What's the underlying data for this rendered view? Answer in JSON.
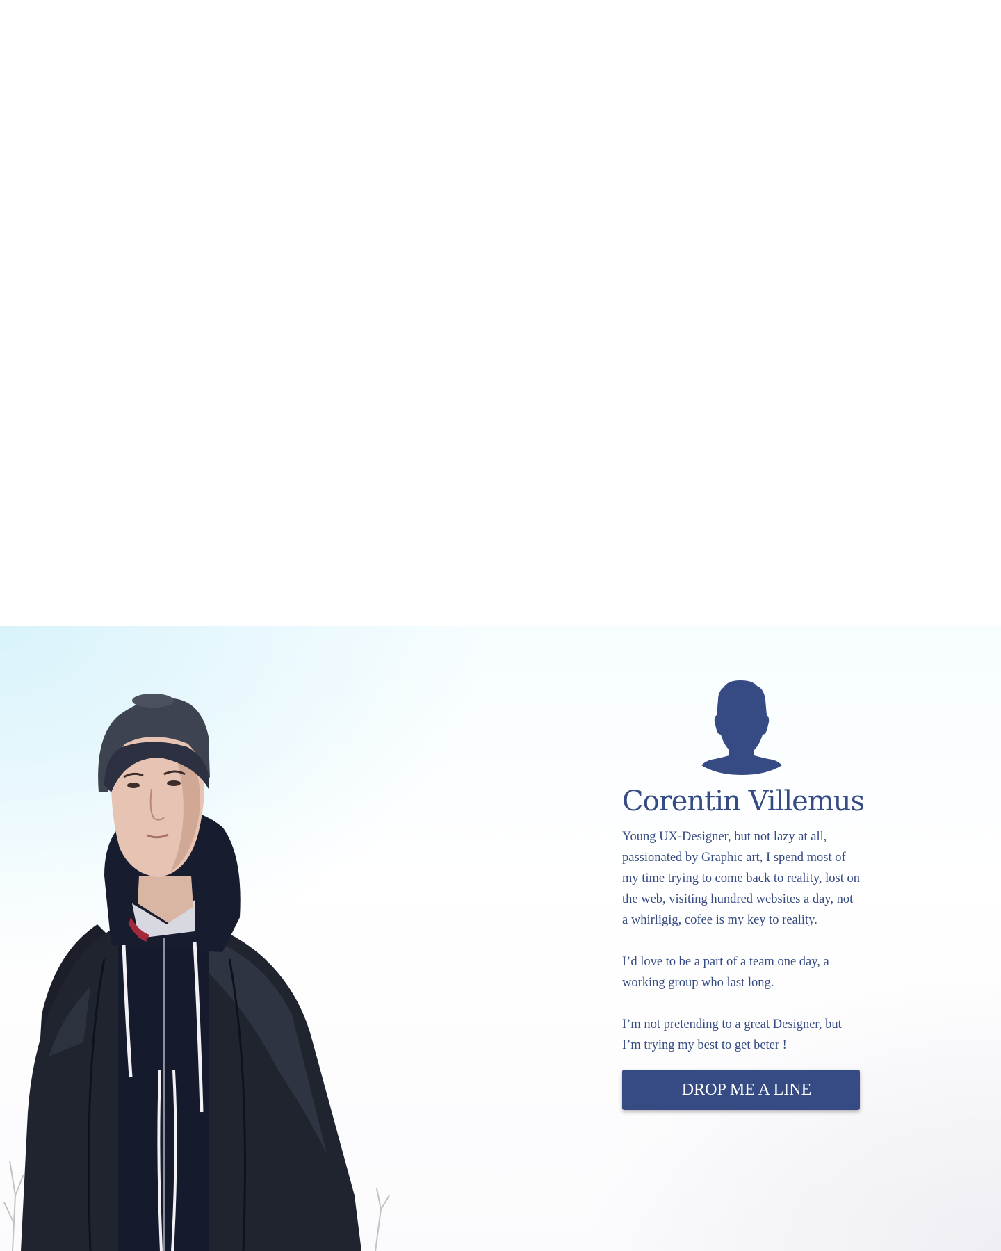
{
  "profile": {
    "name": "Corentin Villemus",
    "avatar_icon": "person-silhouette-icon",
    "bio": [
      "Young UX-Designer, but not lazy at all, passionated by Graphic art, I spend most of my time trying to come back to reality, lost on the web, visiting hundred websites a day, not a whirligig, cofee is my key to reality.",
      "I’d love to be a part of a team one day, a working group who last long.",
      "I’m not pretending to a great Designer, but I’m trying my best to get beter !"
    ],
    "cta_label": "DROP ME A LINE"
  },
  "colors": {
    "accent": "#364b83",
    "background": "#ffffff",
    "sky": "#d9f3fb"
  }
}
